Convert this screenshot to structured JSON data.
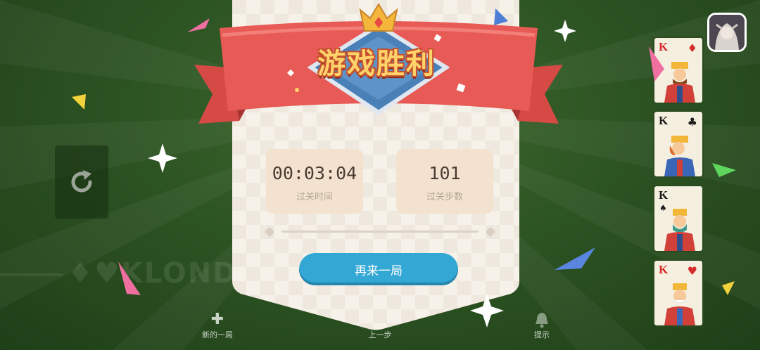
{
  "banner": {
    "title": "游戏胜利"
  },
  "stats": {
    "time_value": "00:03:04",
    "time_label": "过关时间",
    "moves_value": "101",
    "moves_label": "过关步数"
  },
  "replay_button": {
    "label": "再来一局"
  },
  "toolbar": {
    "new_game": {
      "label": "新的一局",
      "icon": "plus-icon"
    },
    "undo": {
      "label": "上一步",
      "icon": "undo-icon"
    },
    "hint": {
      "label": "提示",
      "icon": "bell-icon"
    }
  },
  "watermark": "♦♥KLONDIK",
  "foundation": [
    {
      "rank": "K",
      "suit": "♦",
      "color": "red"
    },
    {
      "rank": "K",
      "suit": "♣",
      "color": "black"
    },
    {
      "rank": "K",
      "suit": "♠",
      "color": "black"
    },
    {
      "rank": "K",
      "suit": "♥",
      "color": "red"
    }
  ],
  "colors": {
    "felt": "#2d5423",
    "panel": "#f6f1e9",
    "ribbon": "#e85a55",
    "accent_button": "#34a8d4",
    "banner_text": "#ffd36a"
  }
}
